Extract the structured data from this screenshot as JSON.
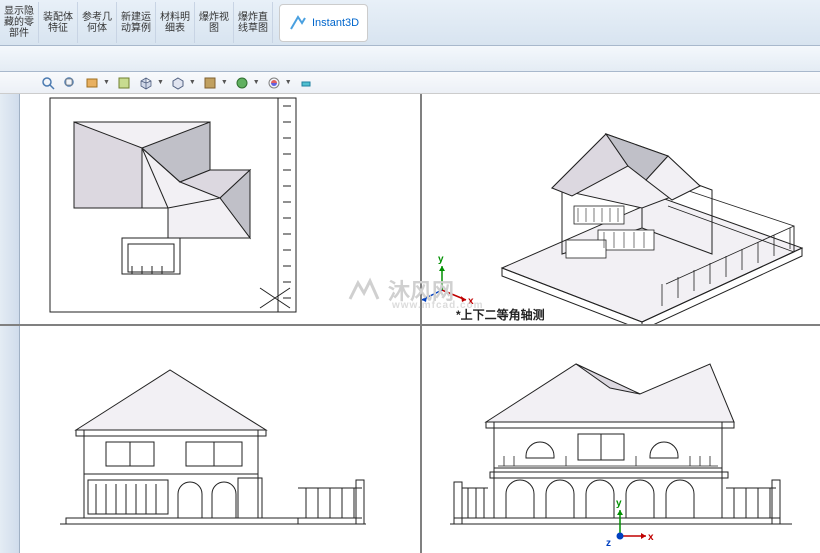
{
  "toolbar": {
    "btn1": "显示隐\n藏的零\n部件",
    "btn2": "装配体\n特征",
    "btn3": "参考几\n何体",
    "btn4": "新建运\n动算例",
    "btn5": "材料明\n细表",
    "btn6": "爆炸视\n图",
    "btn7": "爆炸直\n线草图",
    "instant3d": "Instant3D"
  },
  "viewport": {
    "label_tr": "*上下二等角轴测"
  },
  "watermark": {
    "text": "沐风网",
    "url": "www.mfcad.com"
  },
  "triad": {
    "x": "x",
    "y": "y",
    "z": "z"
  }
}
